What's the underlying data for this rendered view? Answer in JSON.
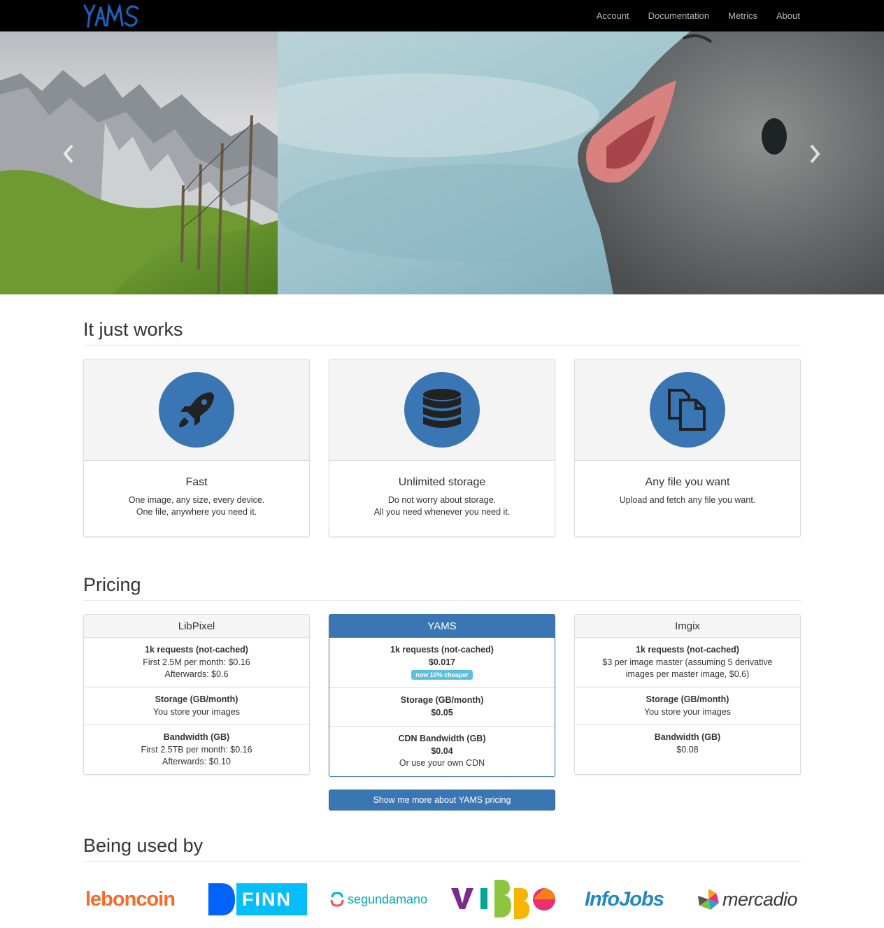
{
  "brand": {
    "name": "YAMS",
    "color": "#1f5fb4"
  },
  "nav": {
    "items": [
      {
        "label": "Account"
      },
      {
        "label": "Documentation"
      },
      {
        "label": "Metrics"
      },
      {
        "label": "About"
      }
    ]
  },
  "carousel": {
    "prev_icon": "chevron-left-icon",
    "next_icon": "chevron-right-icon"
  },
  "features": {
    "title": "It just works",
    "cards": [
      {
        "icon": "rocket-icon",
        "title": "Fast",
        "line1": "One image, any size, every device.",
        "line2": "One file, anywhere you need it."
      },
      {
        "icon": "database-icon",
        "title": "Unlimited storage",
        "line1": "Do not worry about storage.",
        "line2": "All you need whenever you need it."
      },
      {
        "icon": "files-icon",
        "title": "Any file you want",
        "line1": "Upload and fetch any file you want.",
        "line2": ""
      }
    ]
  },
  "pricing": {
    "title": "Pricing",
    "accent": "#3a76b3",
    "plans": [
      {
        "name": "LibPixel",
        "requests": {
          "label": "1k requests (not-cached)",
          "line1": "First 2.5M per month: $0.16",
          "line2": "Afterwards: $0.6"
        },
        "storage": {
          "label": "Storage (GB/month)",
          "line1": "You store your images"
        },
        "bandwidth": {
          "label": "Bandwidth (GB)",
          "line1": "First 2.5TB per month: $0.16",
          "line2": "Afterwards: $0.10"
        }
      },
      {
        "name": "YAMS",
        "requests": {
          "label": "1k requests (not-cached)",
          "line1": "$0.017",
          "badge": "now 10% cheaper"
        },
        "storage": {
          "label": "Storage (GB/month)",
          "line1": "$0.05"
        },
        "bandwidth": {
          "label": "CDN Bandwidth (GB)",
          "line1": "$0.04",
          "line2": "Or use your own CDN"
        }
      },
      {
        "name": "Imgix",
        "requests": {
          "label": "1k requests (not-cached)",
          "line1": "$3 per image master (assuming 5 derivative",
          "line2": "images per master image, $0.6)"
        },
        "storage": {
          "label": "Storage (GB/month)",
          "line1": "You store your images"
        },
        "bandwidth": {
          "label": "Bandwidth (GB)",
          "line1": "$0.08"
        }
      }
    ],
    "button_label": "Show me more about YAMS pricing"
  },
  "clients": {
    "title": "Being used by",
    "logos": [
      {
        "name": "leboncoin",
        "color": "#f56b2a"
      },
      {
        "name": "FINN",
        "color": "#0063fb"
      },
      {
        "name": "segundamano",
        "color": "#00b4c5"
      },
      {
        "name": "VIBBO",
        "color": "#7b2a8e"
      },
      {
        "name": "InfoJobs",
        "color": "#2088c2"
      },
      {
        "name": "mercadio",
        "color": "#3a3a3a"
      }
    ]
  }
}
